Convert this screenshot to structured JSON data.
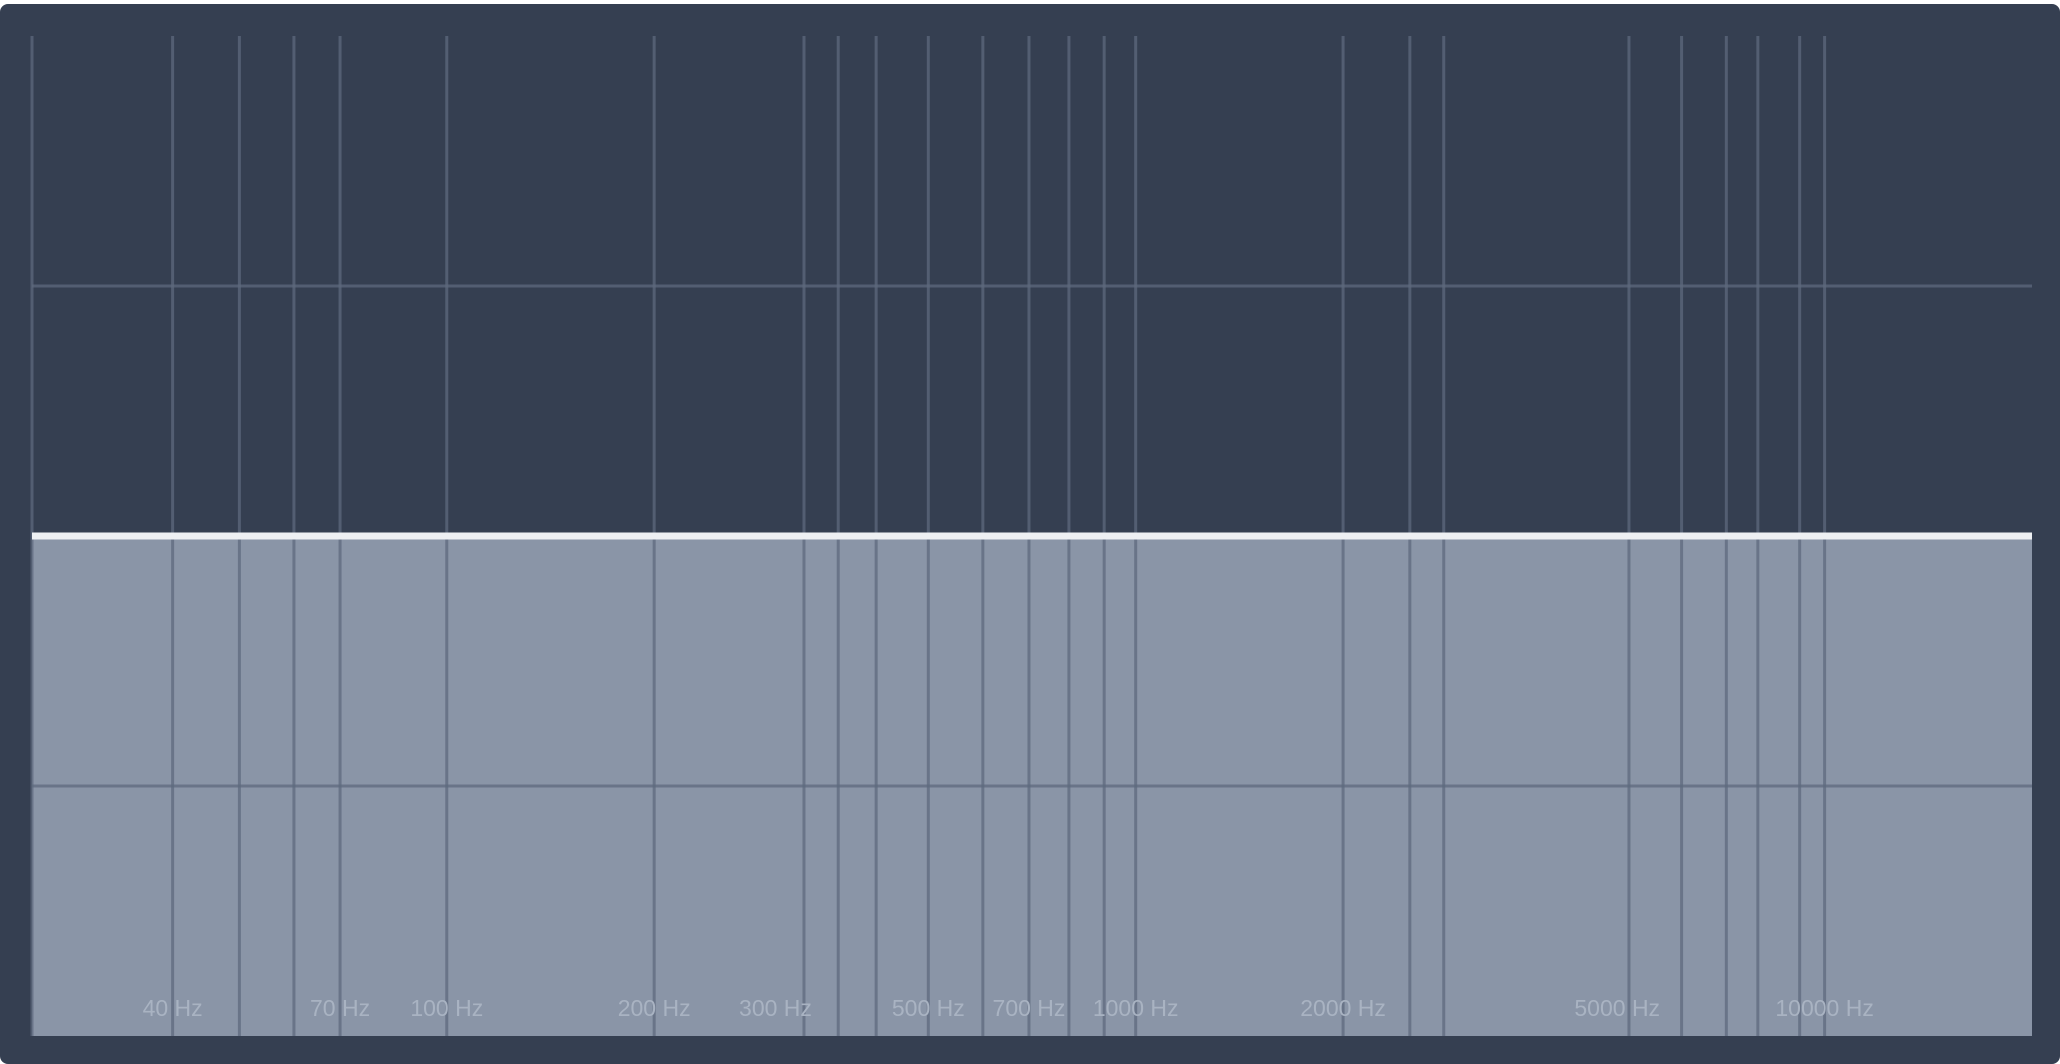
{
  "colors": {
    "panel_background": "#353f51",
    "grid_line": "#5d6a7e",
    "response_fill": "#8a95a7",
    "response_line": "#eef0f3",
    "label": "#a9b3c2"
  },
  "chart_data": {
    "type": "area",
    "title": "",
    "xlabel": "",
    "ylabel": "",
    "x_scale": "log",
    "x_unit": "Hz",
    "xlim": [
      25,
      20000
    ],
    "ylim": [
      -1,
      1
    ],
    "grid": true,
    "vertical_gridlines_hz": [
      25,
      40,
      50,
      60,
      70,
      100,
      200,
      330,
      370,
      420,
      500,
      600,
      700,
      800,
      900,
      1000,
      2000,
      2500,
      2800,
      5200,
      6200,
      7200,
      8000,
      9200,
      10000
    ],
    "horizontal_gridlines": [
      0.5,
      -0.5
    ],
    "tick_labels": [
      {
        "x": 40,
        "label": "40 Hz"
      },
      {
        "x": 70,
        "label": "70 Hz"
      },
      {
        "x": 100,
        "label": "100 Hz"
      },
      {
        "x": 200,
        "label": "200 Hz"
      },
      {
        "x": 300,
        "label": "300 Hz"
      },
      {
        "x": 500,
        "label": "500 Hz"
      },
      {
        "x": 700,
        "label": "700 Hz"
      },
      {
        "x": 1000,
        "label": "1000 Hz"
      },
      {
        "x": 2000,
        "label": "2000 Hz"
      },
      {
        "x": 5000,
        "label": "5000 Hz"
      },
      {
        "x": 10000,
        "label": "10000 Hz"
      }
    ],
    "series": [
      {
        "x": [
          25,
          20000
        ],
        "values": [
          0,
          0
        ]
      }
    ]
  }
}
